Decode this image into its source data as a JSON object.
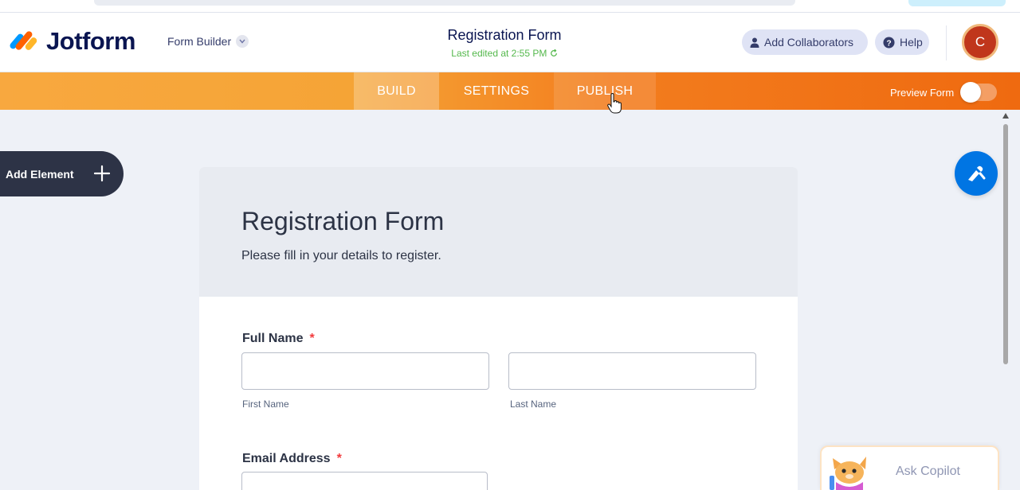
{
  "header": {
    "logo_text": "Jotform",
    "builder_label": "Form Builder",
    "form_title": "Registration Form",
    "last_edited": "Last edited at 2:55 PM",
    "collaborators_label": "Add Collaborators",
    "help_label": "Help",
    "avatar_initial": "C"
  },
  "nav": {
    "tabs": [
      {
        "label": "BUILD"
      },
      {
        "label": "SETTINGS"
      },
      {
        "label": "PUBLISH"
      }
    ],
    "preview_label": "Preview Form",
    "preview_enabled": false
  },
  "sidebar": {
    "add_element_label": "Add Element"
  },
  "form": {
    "title": "Registration Form",
    "subtitle": "Please fill in your details to register.",
    "fields": {
      "full_name": {
        "label": "Full Name",
        "required": "*",
        "first_sub": "First Name",
        "last_sub": "Last Name"
      },
      "email": {
        "label": "Email Address",
        "required": "*"
      }
    }
  },
  "copilot": {
    "label": "Ask Copilot"
  },
  "colors": {
    "nav_start": "#f8a83f",
    "nav_end": "#ef6a10",
    "brand_blue": "#0075e3",
    "edited_green": "#54b84c",
    "required_red": "#f23a3c",
    "avatar_bg": "#c0361b"
  }
}
